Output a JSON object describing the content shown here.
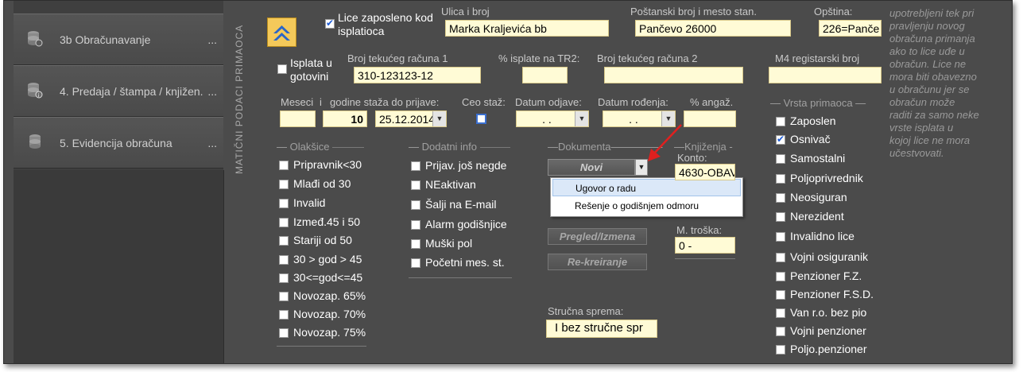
{
  "sidebar": {
    "items": [
      {
        "label": "3b Obračunavanje",
        "dots": "..."
      },
      {
        "label": "4. Predaja / štampa / knjižen...",
        "dots": "..."
      },
      {
        "label": "5. Evidencija obračuna",
        "dots": "..."
      }
    ]
  },
  "section_label": "MATIČNI PODACI PRIMAOCA",
  "header": {
    "lice_zaposleno_label": "Lice zaposleno kod isplatioca",
    "lice_zaposleno_checked": true,
    "ulica_label": "Ulica i broj",
    "ulica_value": "Marka Kraljevića bb",
    "postanski_label": "Poštanski broj i mesto stan.",
    "postanski_value": "Pančevo 26000",
    "opstina_label": "Opština:",
    "opstina_value": "226=Panče"
  },
  "row2": {
    "isplata_label": "Isplata u gotovini",
    "isplata_checked": false,
    "racun1_label": "Broj tekućeg računa 1",
    "racun1_value": "310-123123-12",
    "pct_label": "% isplate na TR2:",
    "pct_value": "",
    "racun2_label": "Broj tekućeg računa 2",
    "racun2_value": "",
    "m4_label": "M4 registarski broj",
    "m4_value": ""
  },
  "row3": {
    "meseci_label": "Meseci",
    "i_label": "i",
    "godine_label": "godine staža do prijave:",
    "meseci_value": "",
    "godine_value": "10",
    "date_value": "25.12.2014",
    "ceo_staz_label": "Ceo staž:",
    "ceo_staz_checked": false,
    "datum_odjave_label": "Datum odjave:",
    "datum_odjave_value": ". .",
    "datum_rodjenja_label": "Datum rođenja:",
    "datum_rodjenja_value": ". .",
    "angaz_label": "% angaž.",
    "angaz_value": ""
  },
  "olaksice": {
    "title": "Olakšice",
    "items": [
      {
        "label": "Pripravnik<30",
        "checked": false
      },
      {
        "label": "Mlađi od 30",
        "checked": false
      },
      {
        "label": "Invalid",
        "checked": false
      },
      {
        "label": "Izmeđ.45 i 50",
        "checked": false
      },
      {
        "label": "Stariji od 50",
        "checked": false
      },
      {
        "label": "30 > god > 45",
        "checked": false
      },
      {
        "label": "30<=god<=45",
        "checked": false
      },
      {
        "label": "Novozap. 65%",
        "checked": false
      },
      {
        "label": "Novozap. 70%",
        "checked": false
      },
      {
        "label": "Novozap. 75%",
        "checked": false
      }
    ]
  },
  "dodatni": {
    "title": "Dodatni info",
    "items": [
      {
        "label": "Prijav. još negde",
        "checked": false
      },
      {
        "label": "NEaktivan",
        "checked": false
      },
      {
        "label": "Šalji na E-mail",
        "checked": false
      },
      {
        "label": "Alarm godišnjice",
        "checked": false
      },
      {
        "label": "Muški pol",
        "checked": false
      },
      {
        "label": "Početni mes. st.",
        "checked": false
      }
    ]
  },
  "dokumenta": {
    "title": "Dokumenta",
    "novi_label": "Novi",
    "dropdown_options": [
      "Ugovor o radu",
      "Rešenje o godišnjem odmoru"
    ],
    "pregled_label": "Pregled/Izmena",
    "rekreiranje_label": "Re-kreiranje"
  },
  "knjizenja": {
    "title": "Knjiženja -",
    "konto_label": "Konto:",
    "konto_value": "4630-OBAV",
    "mtroska_label": "M. troška:",
    "mtroska_value": "0 -"
  },
  "strucna": {
    "label": "Stručna sprema:",
    "value": "I bez stručne spr"
  },
  "vrsta": {
    "title": "Vrsta primaoca",
    "items": [
      {
        "label": "Zaposlen",
        "checked": false
      },
      {
        "label": "Osnivač",
        "checked": true
      },
      {
        "label": "Samostalni",
        "checked": false
      },
      {
        "label": "Poljoprivrednik",
        "checked": false
      },
      {
        "label": "Neosiguran",
        "checked": false
      },
      {
        "label": "Nerezident",
        "checked": false
      },
      {
        "label": "Invalidno lice",
        "checked": false
      },
      {
        "label": "Vojni osiguranik",
        "checked": false
      },
      {
        "label": "Penzioner F.Z.",
        "checked": false
      },
      {
        "label": "Penzioner F.S.D.",
        "checked": false
      },
      {
        "label": "Van r.o. bez pio",
        "checked": false
      },
      {
        "label": "Vojni penzioner",
        "checked": false
      },
      {
        "label": "Poljo.penzioner",
        "checked": false
      }
    ]
  },
  "note": {
    "lines": [
      "upotrebljeni tek pri",
      "pravljenju novog",
      "obračuna primanja",
      "ako to lice uđe u",
      "obračun. Lice ne",
      "mora biti obavezno",
      "u obračunu jer se",
      "obračun može",
      "raditi za samo neke",
      "vrste isplata u",
      "kojoj lice ne mora",
      "učestvovati."
    ]
  },
  "colors": {
    "background": "#4b4b4b",
    "input": "#fffbd6",
    "arrow": "#e0201f",
    "checkmark": "#1d5bd6"
  }
}
